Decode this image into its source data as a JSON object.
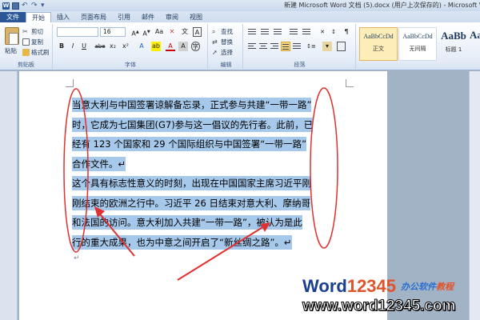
{
  "window": {
    "title": "新建 Microsoft Word 文档 (5).docx (用户上次保存的) - Microsoft Word",
    "qat_logo": "W"
  },
  "tabs": [
    {
      "label": "文件",
      "kind": "file"
    },
    {
      "label": "开始",
      "kind": "active"
    },
    {
      "label": "插入",
      "kind": ""
    },
    {
      "label": "页面布局",
      "kind": ""
    },
    {
      "label": "引用",
      "kind": ""
    },
    {
      "label": "邮件",
      "kind": ""
    },
    {
      "label": "审阅",
      "kind": ""
    },
    {
      "label": "视图",
      "kind": ""
    }
  ],
  "ribbon": {
    "clipboard": {
      "label": "剪贴板",
      "paste": "粘贴",
      "cut": "剪切",
      "copy": "复制",
      "format_painter": "格式刷"
    },
    "font": {
      "label": "字体",
      "font_name": "",
      "font_size": "16",
      "bold": "B",
      "italic": "I",
      "underline": "U",
      "strike": "abe",
      "subscript": "x₂",
      "superscript": "x²",
      "font_color": "A"
    },
    "paragraph": {
      "label": "段落"
    },
    "editing": {
      "label": "编辑",
      "find": "查找",
      "replace": "替换",
      "select": "选择"
    },
    "styles": [
      {
        "sample": "AaBbCcDd",
        "name": "正文",
        "selected": true,
        "size": "8px"
      },
      {
        "sample": "AaBbCcDd",
        "name": "无间隔",
        "selected": false,
        "size": "8px"
      },
      {
        "sample": "AaBb",
        "name": "标题 1",
        "selected": false,
        "size": "13px"
      },
      {
        "sample": "AaB",
        "name": "",
        "selected": false,
        "size": "13px"
      }
    ]
  },
  "document": {
    "lines": [
      "当意大利与中国签署谅解备忘录，正式参与共建“一带一路”",
      "时，它成为七国集团(G7)参与这一倡议的先行者。此前，已",
      "经有 123 个国家和 29 个国际组织与中国签署“一带一路”",
      "合作文件。↵",
      "这个具有标志性意义的时刻，出现在中国国家主席习近平刚",
      "刚结束的欧洲之行中。习近平 26 日结束对意大利、摩纳哥",
      "和法国的访问。意大利加入共建“一带一路”，被认为是此",
      "行的重大成果，也为中意之间开启了“新丝绸之路”。↵"
    ],
    "trailing_mark": "↵",
    "highlight_color": "#a6c8ea"
  },
  "annotation_color": "#e03030",
  "watermark": {
    "brand_w": "W",
    "brand_ord": "ord",
    "brand_num": "12345",
    "subtitle_a": "办公软件",
    "subtitle_b": "教程",
    "url": "www.word12345.com"
  }
}
